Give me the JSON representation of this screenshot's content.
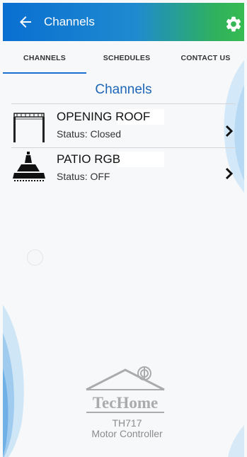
{
  "app": {
    "title": "Channels",
    "back_icon": "arrow-left-icon",
    "settings_icon": "gear-icon",
    "header_colors": [
      "#0a6fd1",
      "#36bb53"
    ]
  },
  "tabs": [
    {
      "label": "CHANNELS",
      "active": true
    },
    {
      "label": "SCHEDULES",
      "active": false
    },
    {
      "label": "CONTACT US",
      "active": false
    }
  ],
  "section_title": "Channels",
  "channels": [
    {
      "name": "OPENING ROOF",
      "status": "Status: Closed",
      "icon": "pergola-icon"
    },
    {
      "name": "PATIO RGB",
      "status": "Status: OFF",
      "icon": "pendant-light-icon"
    }
  ],
  "brand": {
    "name": "TecHome",
    "model": "TH717",
    "product": "Motor Controller"
  }
}
